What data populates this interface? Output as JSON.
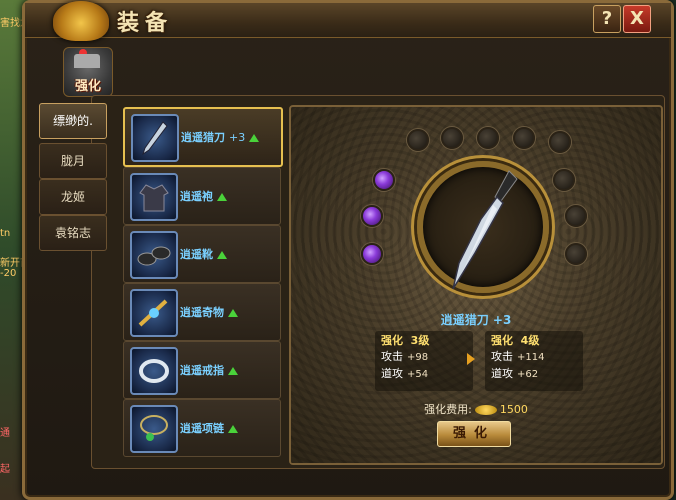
{
  "window": {
    "title": "装备",
    "help_label": "?",
    "close_label": "X"
  },
  "background_left": {
    "fragments": [
      "害找龙栖",
      "tn",
      "新开首",
      "-20",
      "通",
      "起"
    ]
  },
  "tab_icon": {
    "label": "强化"
  },
  "character_tabs": [
    {
      "label": "缥缈的."
    },
    {
      "label": "胧月"
    },
    {
      "label": "龙姬"
    },
    {
      "label": "袁铭志"
    }
  ],
  "equipment": [
    {
      "name": "逍遥猎刀",
      "plus": "+3",
      "icon": "dagger-icon"
    },
    {
      "name": "逍遥袍",
      "plus": "",
      "icon": "robe-icon"
    },
    {
      "name": "逍遥靴",
      "plus": "",
      "icon": "boots-icon"
    },
    {
      "name": "逍遥奇物",
      "plus": "",
      "icon": "artifact-icon"
    },
    {
      "name": "逍遥戒指",
      "plus": "",
      "icon": "ring-icon"
    },
    {
      "name": "逍遥项链",
      "plus": "",
      "icon": "necklace-icon"
    }
  ],
  "forge": {
    "item_name": "逍遥猎刀",
    "item_plus": "+3",
    "current": {
      "level_label": "强化",
      "level": "3级",
      "atk_label": "攻击",
      "atk": "+98",
      "dao_label": "道攻",
      "dao": "+54"
    },
    "next": {
      "level_label": "强化",
      "level": "4级",
      "atk_label": "攻击",
      "atk": "+114",
      "dao_label": "道攻",
      "dao": "+62"
    },
    "cost_label": "强化费用:",
    "cost_value": "1500",
    "button_label": "强化",
    "sockets_lit": 3
  },
  "colors": {
    "item_name": "#7ad0ff",
    "level_text": "#ffe070",
    "upgrade_arrow": "#4ad23a",
    "frame_gold": "#c8a060"
  }
}
